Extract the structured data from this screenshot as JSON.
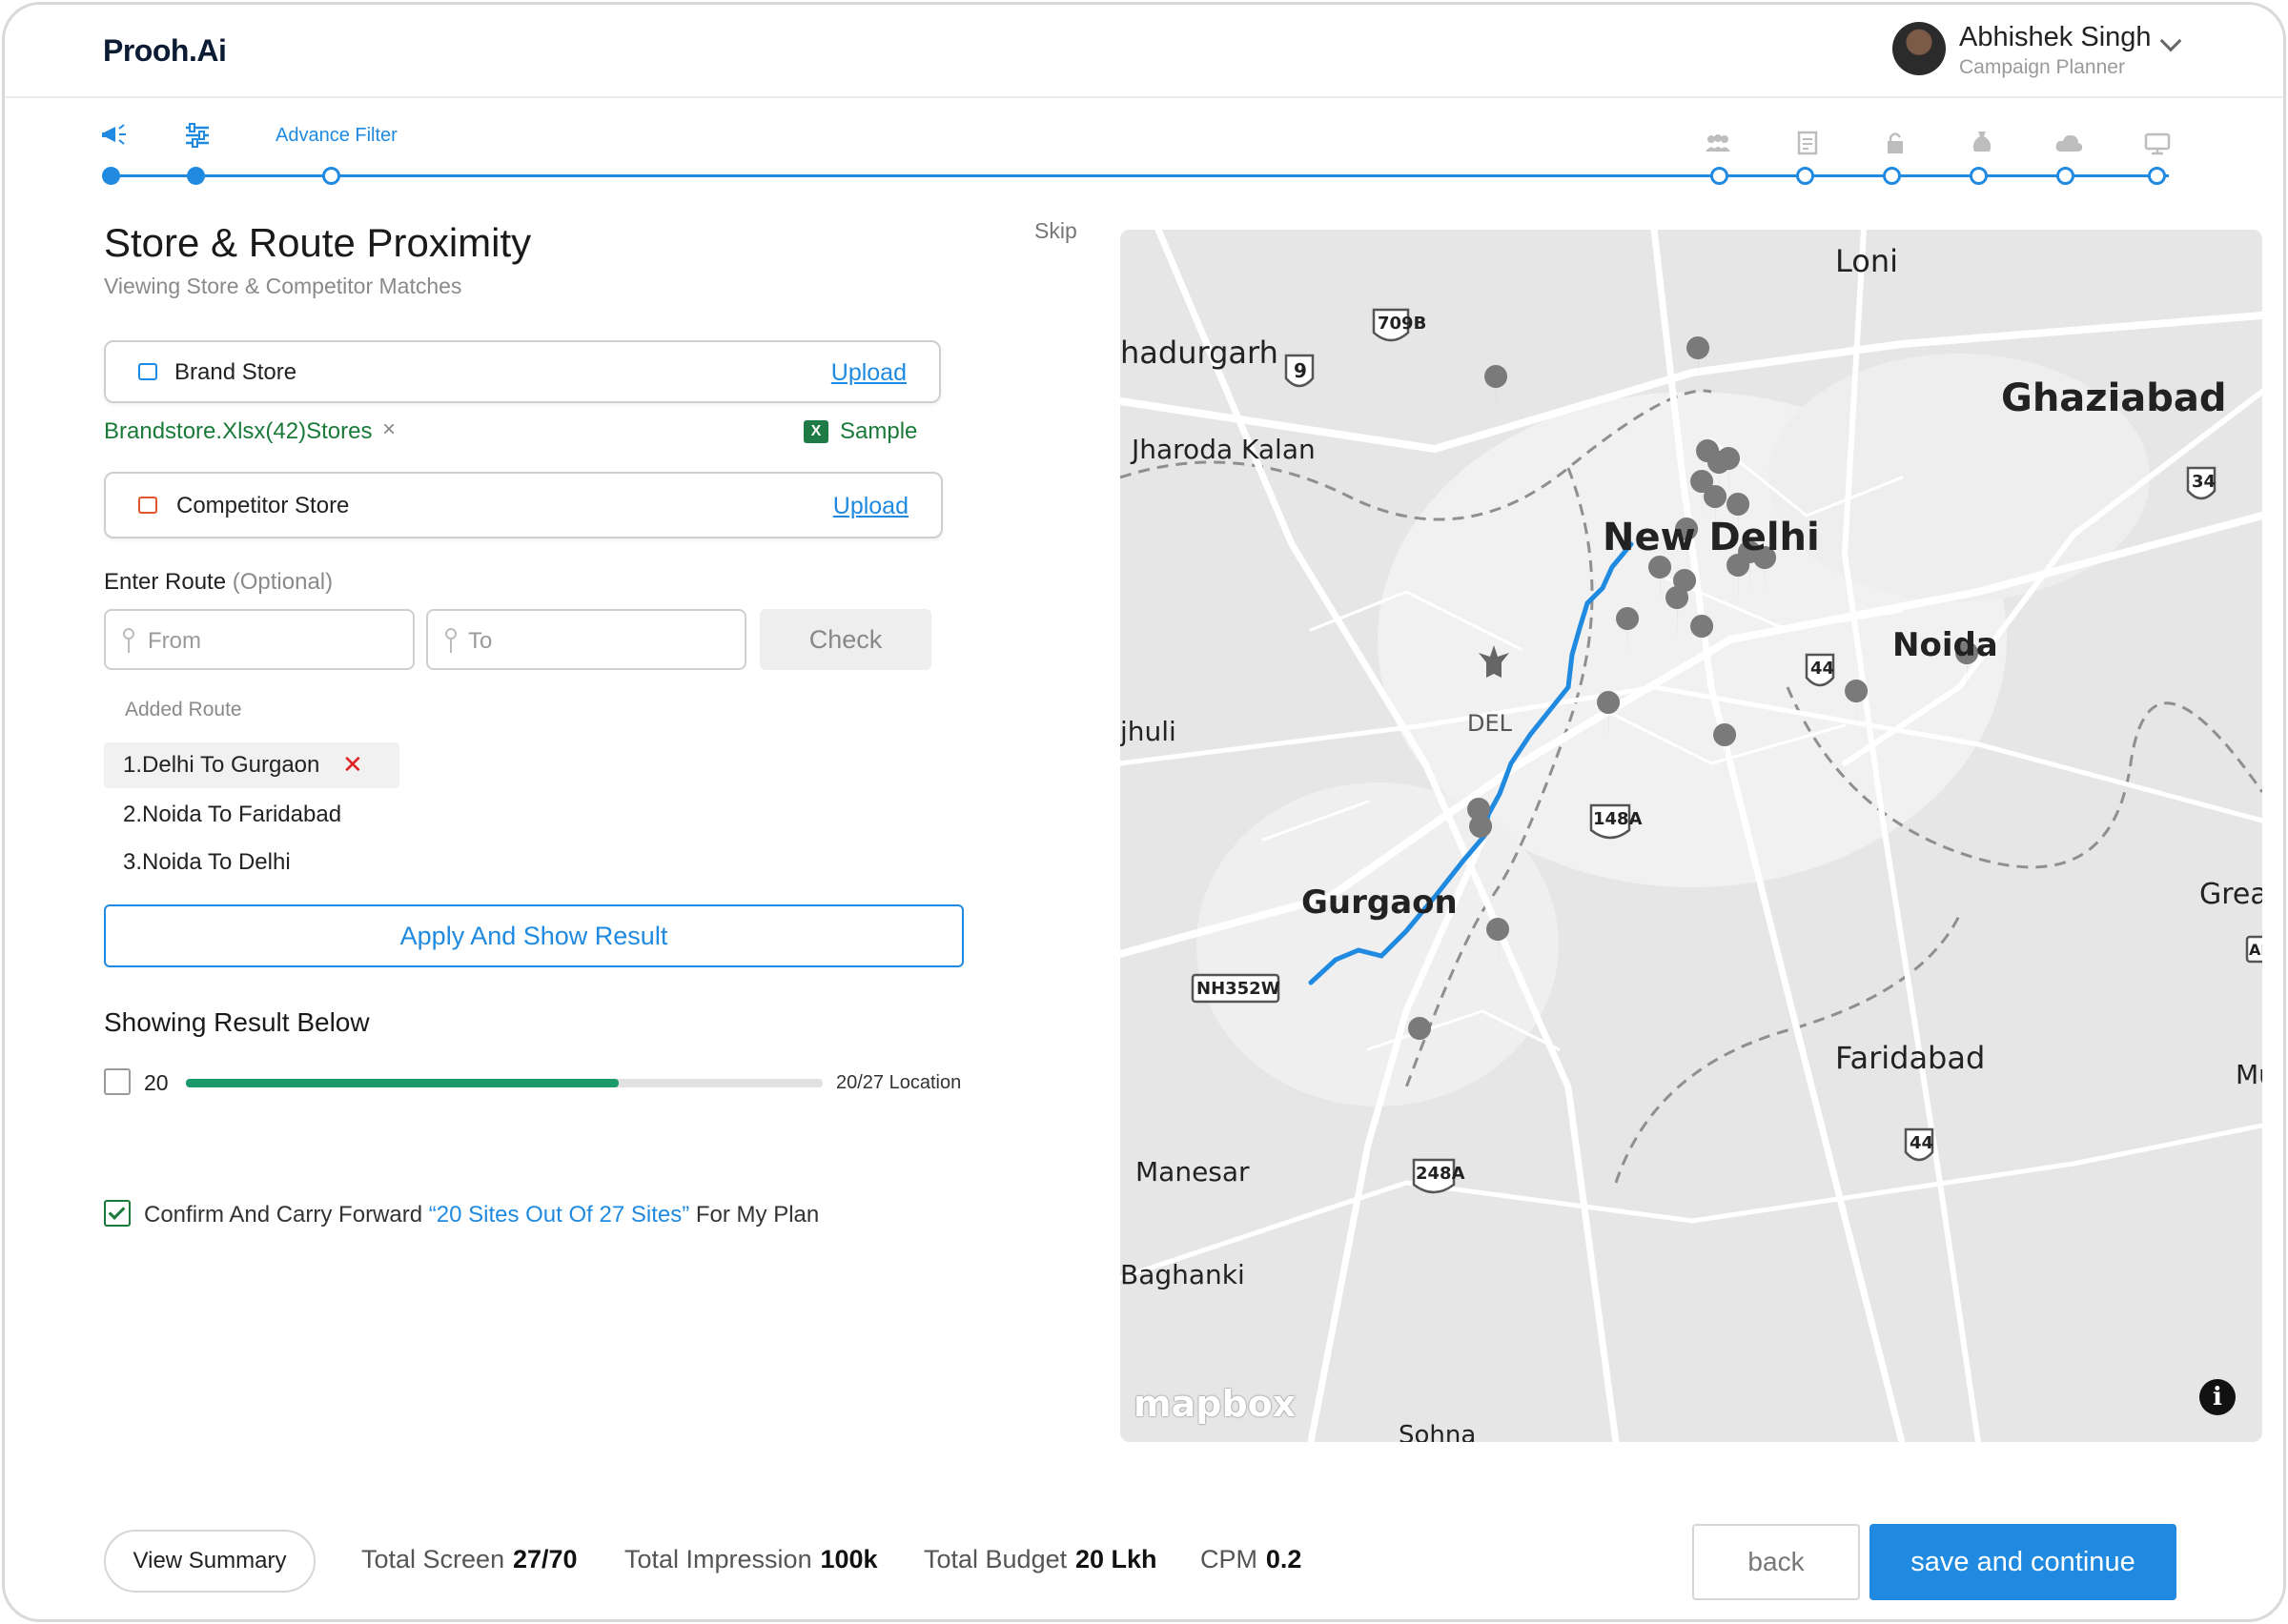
{
  "app": {
    "logo": "Prooh.Ai"
  },
  "user": {
    "name": "Abhishek Singh",
    "role": "Campaign Planner"
  },
  "stepper": {
    "active_label": "Advance Filter",
    "left_icons": [
      "megaphone-icon",
      "sliders-icon"
    ],
    "right_icons": [
      "audience-icon",
      "document-icon",
      "lock-icon",
      "money-bag-icon",
      "cloud-icon",
      "monitor-icon"
    ]
  },
  "skip_label": "Skip",
  "page": {
    "title": "Store & Route Proximity",
    "subtitle": "Viewing Store & Competitor Matches"
  },
  "brand_store": {
    "label": "Brand Store",
    "upload_label": "Upload",
    "file_name": "Brandstore.Xlsx(42)Stores",
    "remove_label": "×",
    "sample_label": "Sample"
  },
  "competitor_store": {
    "label": "Competitor  Store",
    "upload_label": "Upload"
  },
  "route": {
    "label": "Enter Route",
    "optional": "(Optional)",
    "from_placeholder": "From",
    "to_placeholder": "To",
    "check_label": "Check",
    "added_label": "Added Route",
    "items": [
      "1.Delhi To Gurgaon",
      "2.Noida To Faridabad",
      "3.Noida To Delhi"
    ],
    "remove_label": "✕"
  },
  "apply_label": "Apply And Show Result",
  "result": {
    "title": "Showing Result Below",
    "count": "20",
    "progress_fraction": 0.68,
    "progress_label": "20/27 Location"
  },
  "confirm": {
    "prefix": "Confirm  And Carry Forward ",
    "highlight": "“20 Sites Out Of 27 Sites”",
    "suffix": " For My Plan",
    "checked": true
  },
  "map": {
    "places": [
      "Loni",
      "Ghaziabad",
      "hadurgarh",
      "Jharoda Kalan",
      "New Delhi",
      "Noida",
      "DEL",
      "jhuli",
      "Gurgaon",
      "Grea",
      "Faridabad",
      "Manesar",
      "Baghanki",
      "Sohna",
      "Mu"
    ],
    "shields": [
      "709B",
      "9",
      "34",
      "44",
      "148A",
      "NH352W",
      "248A",
      "44",
      "AH"
    ],
    "attribution": "mapbox",
    "info_label": "i",
    "colors": {
      "route": "#1f8ae0",
      "marker": "#7a7a7a",
      "land": "#e6e6e6"
    }
  },
  "footer": {
    "summary_label": "View Summary",
    "stats": [
      {
        "key": "Total Screen",
        "value": "27/70"
      },
      {
        "key": "Total Impression",
        "value": "100k"
      },
      {
        "key": "Total Budget",
        "value": "20 Lkh"
      },
      {
        "key": "CPM",
        "value": "0.2"
      }
    ],
    "back_label": "back",
    "save_label": "save and continue"
  },
  "colors": {
    "accent": "#1f8ae0",
    "success": "#1a7a3a",
    "progress": "#1a9a6a",
    "danger": "#e02020"
  }
}
